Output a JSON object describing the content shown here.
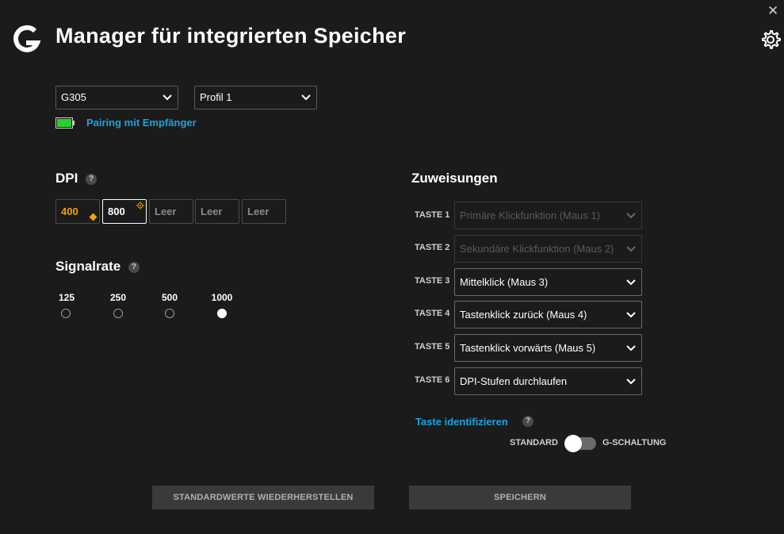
{
  "app": {
    "title": "Manager für integrierten Speicher",
    "close_glyph": "✕"
  },
  "icons": {
    "logo": "logitech-g-logo-icon",
    "settings": "gear-icon",
    "close": "close-icon"
  },
  "device": {
    "selected": "G305",
    "profile": "Profil 1"
  },
  "status": {
    "pairing_text": "Pairing mit Empfänger",
    "battery": "battery-full-icon"
  },
  "dpi": {
    "heading": "DPI",
    "help": "?",
    "stages": [
      {
        "label": "400",
        "state": "default"
      },
      {
        "label": "800",
        "state": "selected"
      },
      {
        "label": "Leer",
        "state": "empty"
      },
      {
        "label": "Leer",
        "state": "empty"
      },
      {
        "label": "Leer",
        "state": "empty"
      }
    ]
  },
  "signalrate": {
    "heading": "Signalrate",
    "help": "?",
    "options": [
      "125",
      "250",
      "500",
      "1000"
    ],
    "selected": "1000"
  },
  "assignments": {
    "heading": "Zuweisungen",
    "rows": [
      {
        "key": "TASTE 1",
        "value": "Primäre Klickfunktion (Maus 1)",
        "disabled": true
      },
      {
        "key": "TASTE 2",
        "value": "Sekundäre Klickfunktion (Maus 2)",
        "disabled": true
      },
      {
        "key": "TASTE 3",
        "value": "Mittelklick (Maus 3)",
        "disabled": false
      },
      {
        "key": "TASTE 4",
        "value": "Tastenklick zurück (Maus 4)",
        "disabled": false
      },
      {
        "key": "TASTE 5",
        "value": "Tastenklick vorwärts (Maus 5)",
        "disabled": false
      },
      {
        "key": "TASTE 6",
        "value": "DPI-Stufen durchlaufen",
        "disabled": false
      }
    ],
    "identify_link": "Taste identifizieren",
    "identify_help": "?",
    "toggle": {
      "left_label": "STANDARD",
      "right_label": "G-SCHALTUNG",
      "state": "STANDARD"
    }
  },
  "buttons": {
    "reset": "STANDARDWERTE WIEDERHERSTELLEN",
    "save": "SPEICHERN"
  },
  "colors": {
    "accent_blue": "#1aa3e0",
    "dpi_default": "#f0a500",
    "battery_green": "#2ecc2e",
    "background": "#1b1b1b"
  }
}
